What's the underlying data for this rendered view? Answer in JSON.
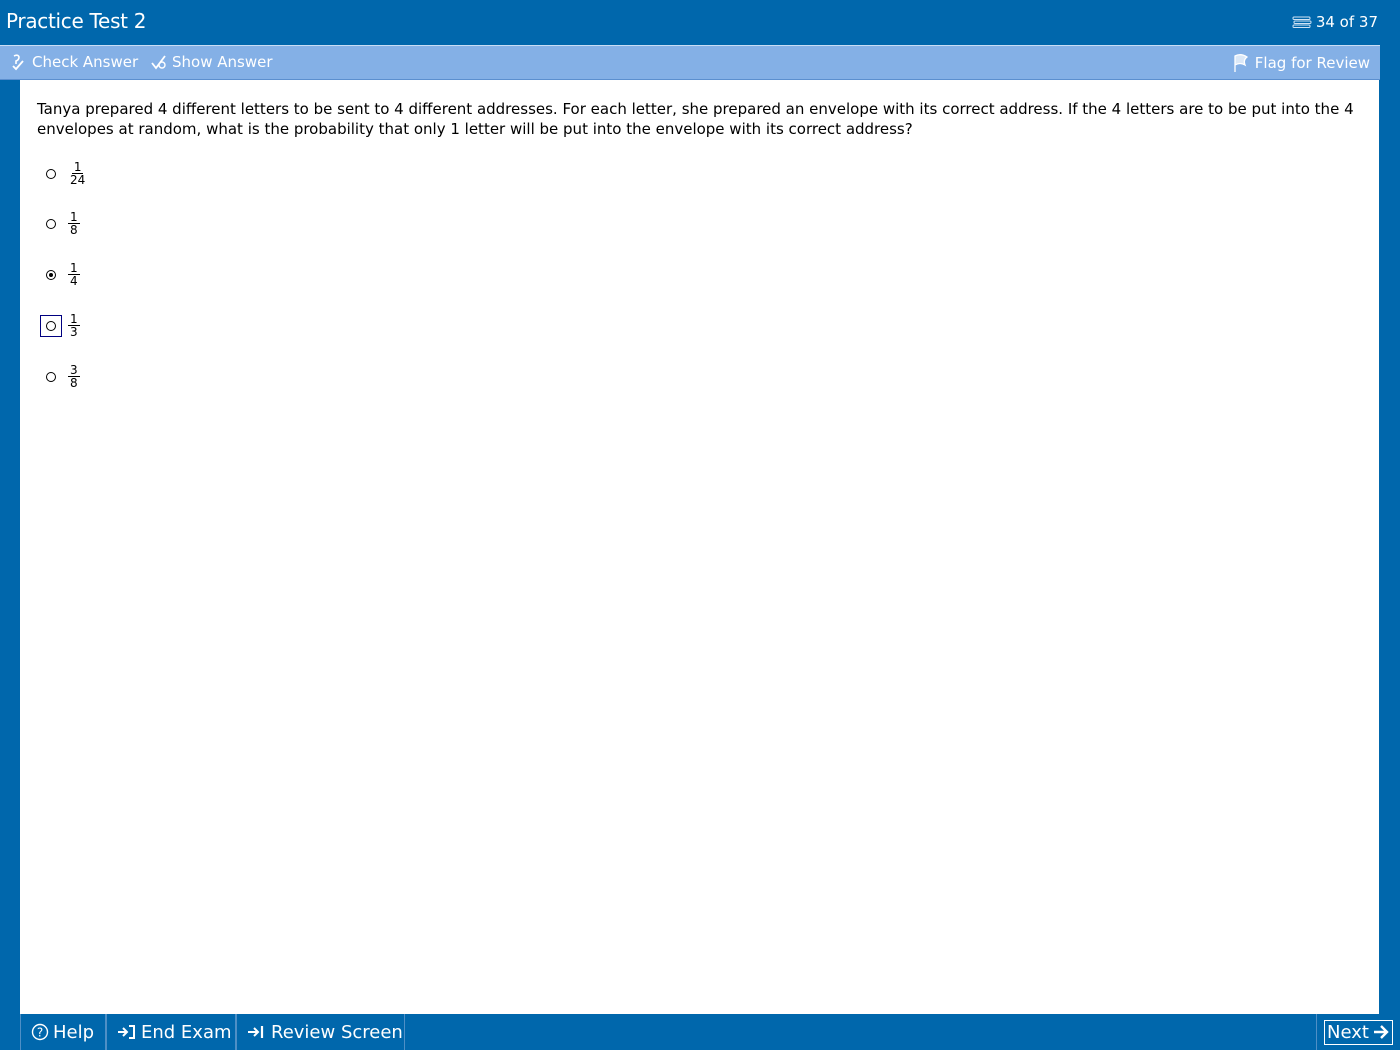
{
  "window": {
    "title": "Practice Test 2",
    "counter": "34 of 37"
  },
  "toolbar": {
    "check_answer": "Check Answer",
    "show_answer": "Show Answer",
    "flag_for_review": "Flag for Review"
  },
  "question": {
    "text": "Tanya prepared 4 different letters to be sent to 4 different addresses.  For each letter, she prepared an envelope with its correct address.  If the 4 letters are to be put into the 4 envelopes at random, what is the probability that only 1 letter will be put into the envelope with its correct address?",
    "choices": [
      {
        "numerator": "1",
        "denominator": "24",
        "selected": false,
        "focused": false
      },
      {
        "numerator": "1",
        "denominator": "8",
        "selected": false,
        "focused": false
      },
      {
        "numerator": "1",
        "denominator": "4",
        "selected": true,
        "focused": false
      },
      {
        "numerator": "1",
        "denominator": "3",
        "selected": false,
        "focused": true
      },
      {
        "numerator": "3",
        "denominator": "8",
        "selected": false,
        "focused": false
      }
    ]
  },
  "bottombar": {
    "help": "Help",
    "end_exam": "End Exam",
    "review_screen": "Review Screen",
    "next": "Next"
  },
  "colors": {
    "frame": "#0067ac",
    "toolbar": "#84b0e6"
  }
}
